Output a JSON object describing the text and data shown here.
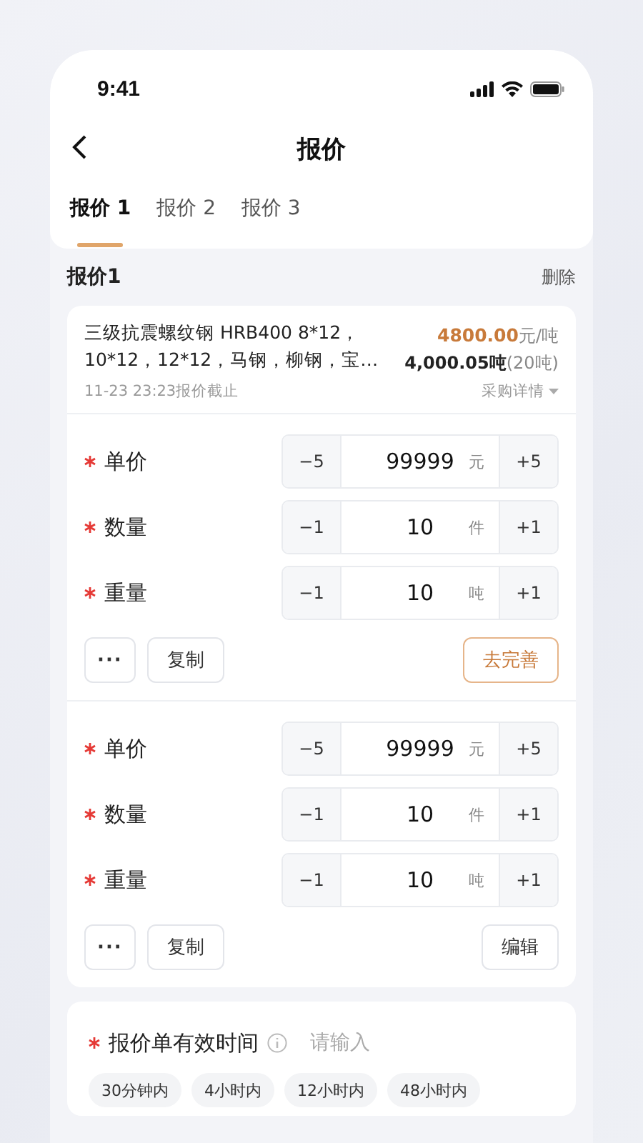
{
  "status_bar": {
    "time": "9:41"
  },
  "nav": {
    "title": "报价"
  },
  "tabs": [
    {
      "label": "报价 1",
      "selected": true
    },
    {
      "label": "报价 2",
      "selected": false
    },
    {
      "label": "报价 3",
      "selected": false
    }
  ],
  "quote": {
    "title": "报价1",
    "delete_label": "删除",
    "product": {
      "name": "三级抗震螺纹钢 HRB400 8*12，10*12，12*12，马钢，柳钢，宝…",
      "price": "4800.00",
      "price_unit": "元/吨",
      "weight": "4,000.05吨",
      "weight_note": "(20吨)",
      "deadline": "11-23 23:23报价截止",
      "details_link": "采购详情"
    },
    "items": [
      {
        "fields": [
          {
            "label": "单价",
            "required": true,
            "minus": "−5",
            "value": "99999",
            "unit": "元",
            "plus": "+5"
          },
          {
            "label": "数量",
            "required": true,
            "minus": "−1",
            "value": "10",
            "unit": "件",
            "plus": "+1"
          },
          {
            "label": "重量",
            "required": true,
            "minus": "−1",
            "value": "10",
            "unit": "吨",
            "plus": "+1"
          }
        ],
        "more_label": "···",
        "copy_label": "复制",
        "action": {
          "label": "去完善",
          "kind": "accent"
        }
      },
      {
        "fields": [
          {
            "label": "单价",
            "required": true,
            "minus": "−5",
            "value": "99999",
            "unit": "元",
            "plus": "+5"
          },
          {
            "label": "数量",
            "required": true,
            "minus": "−1",
            "value": "10",
            "unit": "件",
            "plus": "+1"
          },
          {
            "label": "重量",
            "required": true,
            "minus": "−1",
            "value": "10",
            "unit": "吨",
            "plus": "+1"
          }
        ],
        "more_label": "···",
        "copy_label": "复制",
        "action": {
          "label": "编辑",
          "kind": "plain"
        }
      }
    ]
  },
  "validity": {
    "label": "报价单有效时间",
    "required": true,
    "placeholder": "请输入",
    "options": [
      {
        "label": "30分钟内",
        "selected": false
      },
      {
        "label": "4小时内",
        "selected": false
      },
      {
        "label": "12小时内",
        "selected": false
      },
      {
        "label": "48小时内",
        "selected": false
      }
    ]
  }
}
